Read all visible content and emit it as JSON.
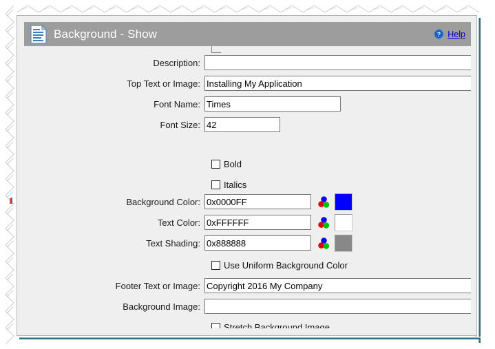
{
  "window": {
    "title": "Background - Show",
    "title_icon": "document-icon",
    "help_icon": "help-circle-icon",
    "help_label": "Help"
  },
  "colors": {
    "title_bar_bg": "#9d9d9d",
    "title_text": "#ffffff",
    "form_bg": "#efefef",
    "help_link": "#0000cc",
    "accent_rail": "#2e6b85"
  },
  "form": {
    "fields": [
      {
        "name": "description",
        "label": "Description:",
        "value": "",
        "placeholder": "",
        "has_browse": false
      },
      {
        "name": "top-text-or-image",
        "label": "Top Text or Image:",
        "value": "Installing My Application",
        "placeholder": "",
        "has_browse": true
      },
      {
        "name": "font-name",
        "label": "Font Name:",
        "value": "Times",
        "placeholder": "",
        "has_browse": false
      },
      {
        "name": "font-size",
        "label": "Font Size:",
        "value": "42",
        "placeholder": "",
        "has_browse": false
      }
    ],
    "checkboxes": [
      {
        "name": "bold",
        "label": "Bold",
        "checked": false
      },
      {
        "name": "italics",
        "label": "Italics",
        "checked": false
      },
      {
        "name": "use-uniform-background-color",
        "label": "Use Uniform Background Color",
        "checked": false
      },
      {
        "name": "stretch-background-image",
        "label": "Stretch Background Image",
        "checked": false
      }
    ],
    "color_fields": [
      {
        "name": "background-color",
        "label": "Background Color:",
        "value": "0x0000FF",
        "swatch": "#0000FF"
      },
      {
        "name": "text-color",
        "label": "Text Color:",
        "value": "0xFFFFFF",
        "swatch": "#FFFFFF"
      },
      {
        "name": "text-shading",
        "label": "Text Shading:",
        "value": "0x888888",
        "swatch": "#888888"
      }
    ],
    "image_fields": [
      {
        "name": "footer-text-or-image",
        "label": "Footer Text or Image:",
        "value": "Copyright 2016 My Company",
        "placeholder": "",
        "has_browse": true
      },
      {
        "name": "background-image",
        "label": "Background Image:",
        "value": "",
        "placeholder": "",
        "has_browse": true
      }
    ]
  }
}
